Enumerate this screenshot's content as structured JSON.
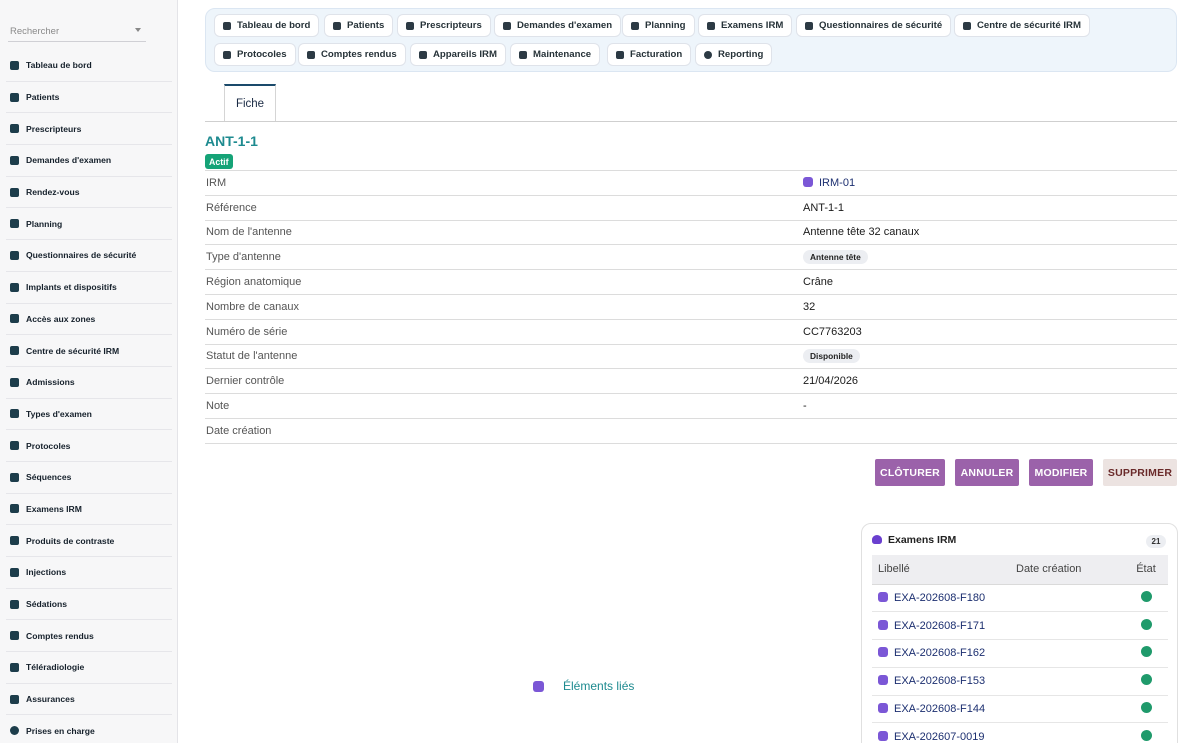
{
  "sidebar": {
    "search_placeholder": "Rechercher",
    "items": [
      {
        "label": "Tableau de bord",
        "icon": "gauge-icon"
      },
      {
        "label": "Patients",
        "icon": "user-icon"
      },
      {
        "label": "Prescripteurs",
        "icon": "user-doctor-icon"
      },
      {
        "label": "Demandes d'examen",
        "icon": "file-icon"
      },
      {
        "label": "Rendez-vous",
        "icon": "calendar-icon"
      },
      {
        "label": "Planning",
        "icon": "calendar-check-icon"
      },
      {
        "label": "Questionnaires de sécurité",
        "icon": "shield-icon"
      },
      {
        "label": "Implants et dispositifs",
        "icon": "chip-icon"
      },
      {
        "label": "Accès aux zones",
        "icon": "lock-icon"
      },
      {
        "label": "Centre de sécurité IRM",
        "icon": "warning-icon"
      },
      {
        "label": "Admissions",
        "icon": "clipboard-icon"
      },
      {
        "label": "Types d'examen",
        "icon": "list-icon"
      },
      {
        "label": "Protocoles",
        "icon": "clipboard-list-icon"
      },
      {
        "label": "Séquences",
        "icon": "lines-icon"
      },
      {
        "label": "Examens IRM",
        "icon": "heartbeat-icon"
      },
      {
        "label": "Produits de contraste",
        "icon": "flask-icon"
      },
      {
        "label": "Injections",
        "icon": "syringe-icon"
      },
      {
        "label": "Sédations",
        "icon": "bed-icon"
      },
      {
        "label": "Comptes rendus",
        "icon": "report-icon"
      },
      {
        "label": "Téléradiologie",
        "icon": "satellite-icon"
      },
      {
        "label": "Assurances",
        "icon": "id-card-icon"
      },
      {
        "label": "Prises en charge",
        "icon": "circle-icon"
      }
    ]
  },
  "topnav": {
    "tabs": [
      {
        "label": "Tableau de bord",
        "icon": "gauge-icon"
      },
      {
        "label": "Patients",
        "icon": "user-icon"
      },
      {
        "label": "Prescripteurs",
        "icon": "user-doctor-icon"
      },
      {
        "label": "Demandes d'examen",
        "icon": "file-icon"
      },
      {
        "label": "Planning",
        "icon": "calendar-check-icon"
      },
      {
        "label": "Examens IRM",
        "icon": "heartbeat-icon"
      },
      {
        "label": "Questionnaires de sécurité",
        "icon": "shield-icon"
      },
      {
        "label": "Centre de sécurité IRM",
        "icon": "warning-icon"
      },
      {
        "label": "Protocoles",
        "icon": "clipboard-list-icon"
      },
      {
        "label": "Comptes rendus",
        "icon": "report-icon"
      },
      {
        "label": "Appareils IRM",
        "icon": "magnet-icon"
      },
      {
        "label": "Maintenance",
        "icon": "gears-icon"
      },
      {
        "label": "Facturation",
        "icon": "invoice-icon"
      },
      {
        "label": "Reporting",
        "icon": "pie-chart-icon"
      }
    ]
  },
  "record": {
    "tab_label": "Fiche",
    "title": "ANT-1-1",
    "status": "Actif",
    "fields": [
      {
        "label": "IRM",
        "value": "IRM-01"
      },
      {
        "label": "Référence",
        "value": "ANT-1-1"
      },
      {
        "label": "Nom de l'antenne",
        "value": "Antenne tête 32 canaux"
      },
      {
        "label": "Type d'antenne",
        "value": "Antenne tête"
      },
      {
        "label": "Région anatomique",
        "value": "Crâne"
      },
      {
        "label": "Nombre de canaux",
        "value": "32"
      },
      {
        "label": "Numéro de série",
        "value": "CC7763203"
      },
      {
        "label": "Statut de l'antenne",
        "value": "Disponible"
      },
      {
        "label": "Dernier contrôle",
        "value": "21/04/2026"
      },
      {
        "label": "Note",
        "value": "-"
      },
      {
        "label": "Date création",
        "value": ""
      }
    ]
  },
  "actions": {
    "close": "CLÔTURER",
    "cancel": "ANNULER",
    "edit": "MODIFIER",
    "delete": "SUPPRIMER"
  },
  "related": {
    "label": "Éléments liés"
  },
  "exams_panel": {
    "title": "Examens IRM",
    "count": "21",
    "columns": {
      "libelle": "Libellé",
      "date": "Date création",
      "etat": "État"
    },
    "rows": [
      {
        "libelle": "EXA-202608-F180",
        "date": "",
        "state_color": "#1f9a6b"
      },
      {
        "libelle": "EXA-202608-F171",
        "date": "",
        "state_color": "#1f9a6b"
      },
      {
        "libelle": "EXA-202608-F162",
        "date": "",
        "state_color": "#1f9a6b"
      },
      {
        "libelle": "EXA-202608-F153",
        "date": "",
        "state_color": "#1f9a6b"
      },
      {
        "libelle": "EXA-202608-F144",
        "date": "",
        "state_color": "#1f9a6b"
      },
      {
        "libelle": "EXA-202607-0019",
        "date": "",
        "state_color": "#1f9a6b"
      }
    ]
  },
  "colors": {
    "accent_teal": "#1d8a8f",
    "status_green": "#15a377",
    "action_purple": "#9b62aa",
    "icon_purple": "#7b57d6"
  }
}
